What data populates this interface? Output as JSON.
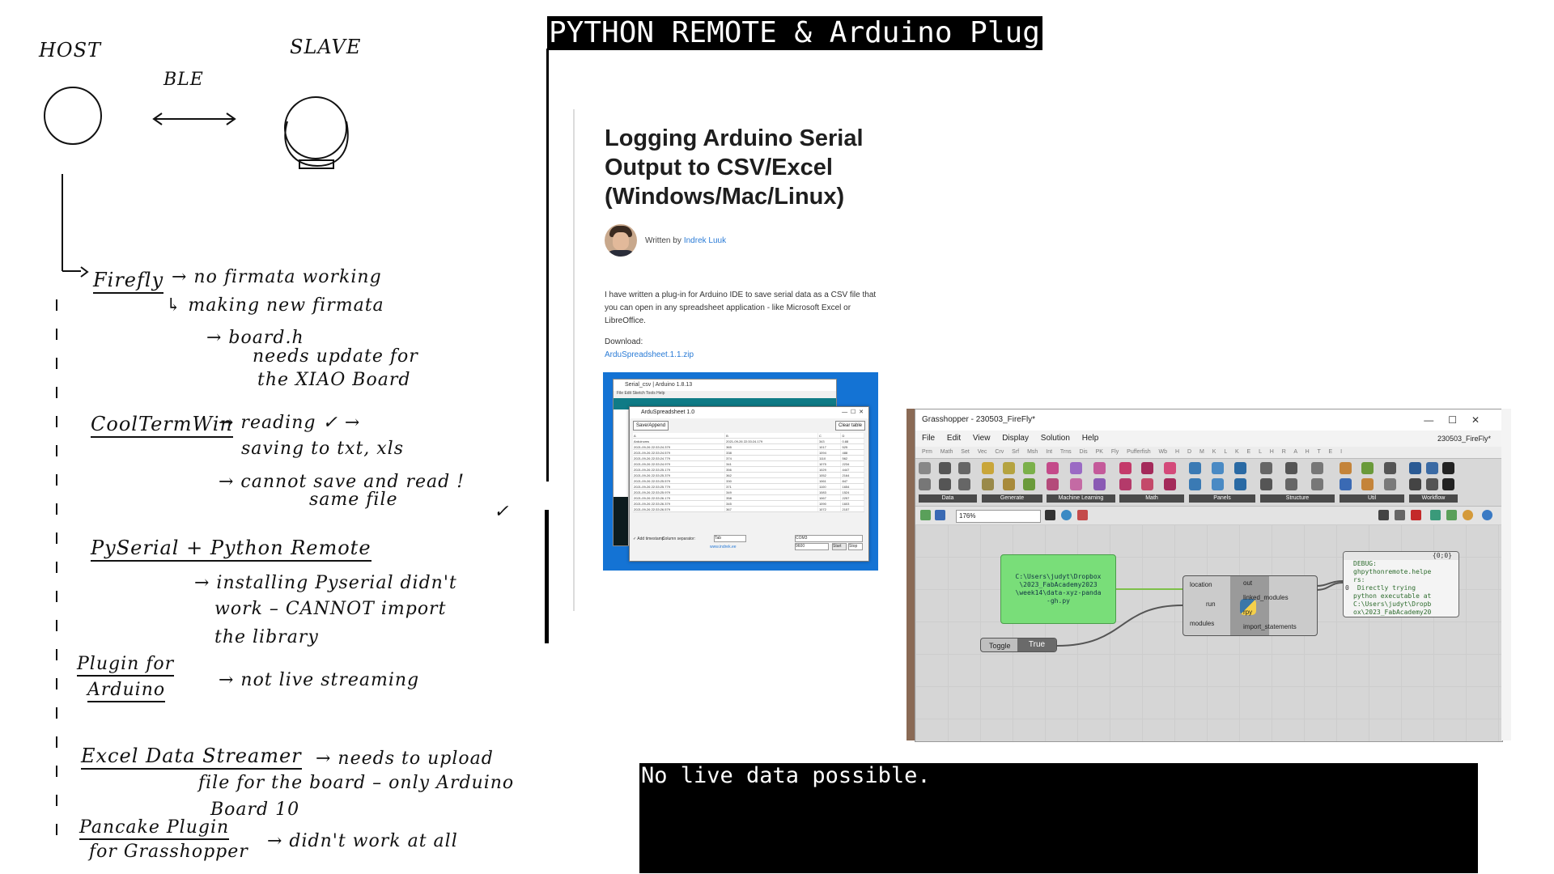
{
  "title": "PYTHON REMOTE & Arduino Plugin",
  "message": "No live data possible.",
  "notes": {
    "host": "HOST",
    "slave": "SLAVE",
    "ble": "BLE",
    "firefly": {
      "label": "Firefly",
      "line1": "→ no firmata working",
      "line2": "↳ making new firmata",
      "line3": "→ board.h",
      "line4": "needs update for",
      "line5": "the XIAO Board"
    },
    "coolterm": {
      "label": "CoolTermWin",
      "line1": "→ reading ✓ →",
      "line2": "saving to txt, xls",
      "line3": "→ cannot save and read !",
      "line4": "same file"
    },
    "pyserial": {
      "label": "PySerial + Python Remote",
      "line1": "→ installing Pyserial didn't",
      "line2": "work – CANNOT import",
      "line3": "the library"
    },
    "plugin": {
      "label1": "Plugin for",
      "label2": "Arduino",
      "line1": "→ not live streaming"
    },
    "excel": {
      "label": "Excel Data Streamer",
      "line1": "→ needs to upload",
      "line2": "file for the board – only Arduino",
      "line3": "Board 10"
    },
    "pancake": {
      "label": "Pancake Plugin",
      "line1": "for Grasshopper",
      "line2": "→ didn't work at all"
    },
    "stray": "✓"
  },
  "article": {
    "title": "Logging Arduino Serial Output to CSV/Excel (Windows/Mac/Linux)",
    "written_by": "Written by",
    "author": "Indrek Luuk",
    "body": "I have written a plug-in for Arduino IDE to save serial data as a CSV file that you can open in any spreadsheet application - like Microsoft Excel or LibreOffice.",
    "download_label": "Download:",
    "download_link": "ArduSpreadsheet.1.1.zip",
    "screenshot": {
      "ide_title": "Serial_csv | Arduino 1.8.13",
      "ide_menu": "File Edit Sketch Tools Help",
      "app_title": "ArduSpreadsheet 1.0",
      "save_button": "Save/Append",
      "clear_button": "Clear table",
      "columns": [
        "A",
        "B",
        "C",
        "D"
      ],
      "rows": [
        [
          "Arduinoms",
          "2021-09-26 22:33:24.179",
          "343",
          "0.88"
        ],
        [
          "2021-09-26 22:33:24.379",
          "365",
          "1017",
          "525"
        ],
        [
          "2021-09-26 22:33:24.579",
          "338",
          "1094",
          "488"
        ],
        [
          "2021-09-26 22:33:24.779",
          "374",
          "1110",
          "562"
        ],
        [
          "2021-09-26 22:33:24.979",
          "341",
          "1075",
          "2234"
        ],
        [
          "2021-09-26 22:33:25.179",
          "356",
          "1029",
          "4447"
        ],
        [
          "2021-09-26 22:33:25.379",
          "362",
          "1052",
          "2164"
        ],
        [
          "2021-09-26 22:33:25.579",
          "330",
          "1061",
          "847"
        ],
        [
          "2021-09-26 22:33:25.779",
          "371",
          "1100",
          "1654"
        ],
        [
          "2021-09-26 22:33:25.979",
          "349",
          "1083",
          "1524"
        ],
        [
          "2021-09-26 22:33:26.179",
          "358",
          "1067",
          "2257"
        ],
        [
          "2021-09-26 22:33:26.379",
          "345",
          "1090",
          "1603"
        ],
        [
          "2021-09-26 22:33:26.579",
          "367",
          "1072",
          "2157"
        ]
      ],
      "add_timestamp": "✓ Add timestamp",
      "column_separator_label": "Column separator:",
      "column_separator_value": "Tab",
      "port": "COM3",
      "baud": "9600",
      "start_button": "Start",
      "stop_button": "Stop",
      "link": "www.indrek.ee"
    }
  },
  "grasshopper": {
    "window_title": "Grasshopper - 230503_FireFly*",
    "doc_title": "230503_FireFly*",
    "menu": [
      "File",
      "Edit",
      "View",
      "Display",
      "Solution",
      "Help"
    ],
    "tabs": "Prm Math Set Vec Crv Srf Msh Int Trns Dis PK Fly Pufferfish Wb H D M K L K E L H R A H T E I",
    "ribbon_groups": [
      "Data",
      "Generate",
      "Machine Learning",
      "Math",
      "Panels",
      "Structure",
      "Util",
      "Workflow"
    ],
    "zoom": "176%",
    "panel_text": "C:\\Users\\judyt\\Dropbox\n\\2023_FabAcademy2023\n\\week14\\data-xyz-panda\n-gh.py",
    "component": {
      "inputs": [
        "location",
        "run",
        "modules"
      ],
      "outputs": [
        "out",
        "linked_modules",
        "rpy",
        "import_statements"
      ]
    },
    "toggle_label": "Toggle",
    "toggle_value": "True",
    "debug_header": "{0;0}",
    "debug_index": "0",
    "debug_text": "DEBUG:\nghpythonremote.helpe\nrs:\n Directly trying\npython executable at\nC:\\Users\\judyt\\Dropb\nox\\2023_FabAcademy20"
  }
}
